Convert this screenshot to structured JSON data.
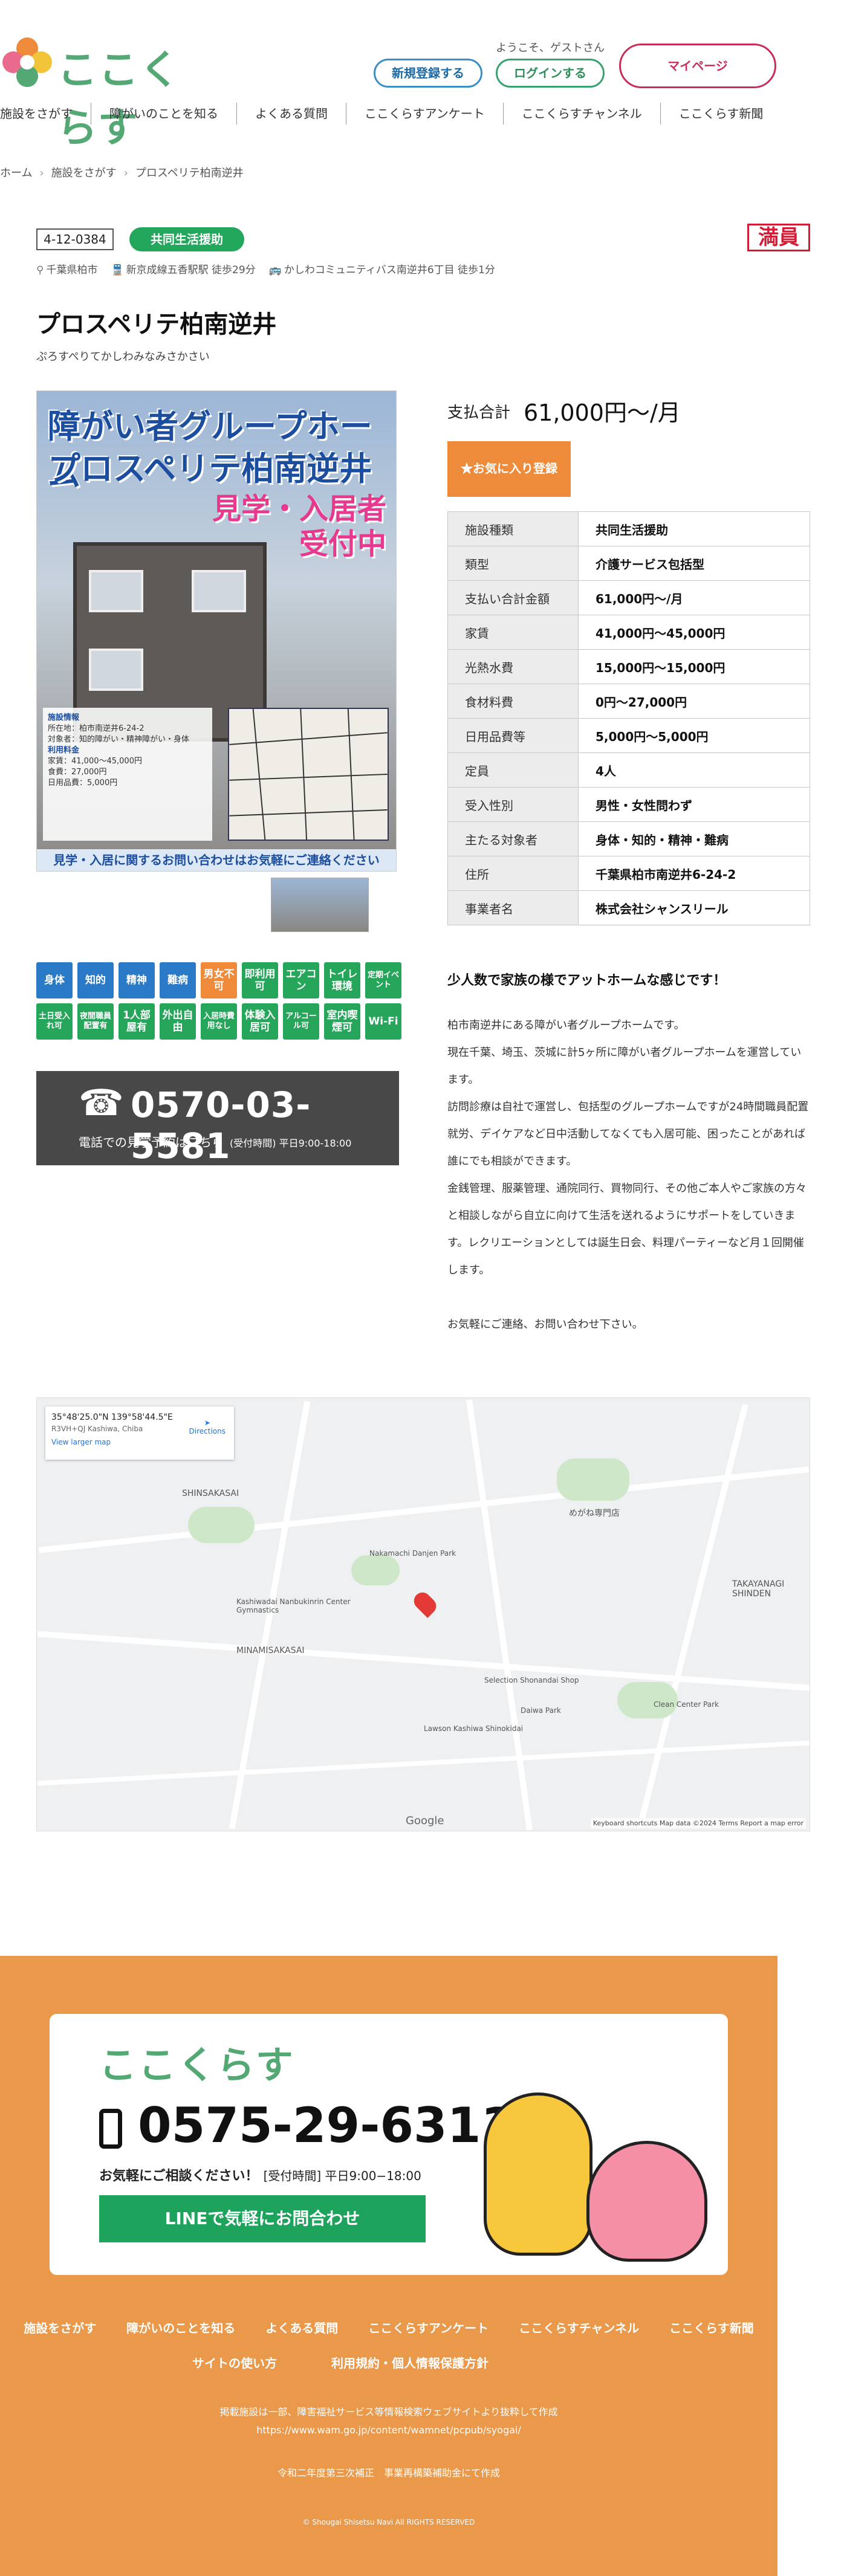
{
  "header": {
    "logo_text": "ここくらす",
    "welcome": "ようこそ、ゲストさん",
    "register_label": "新規登録する",
    "login_label": "ログインする",
    "mypage_label": "マイページ"
  },
  "nav": [
    "施設をさがす",
    "障がいのことを知る",
    "よくある質問",
    "ここくらすアンケート",
    "ここくらすチャンネル",
    "ここくらす新聞"
  ],
  "breadcrumb": [
    "ホーム",
    "施設をさがす",
    "プロスペリテ柏南逆井"
  ],
  "facility": {
    "id": "4-12-0384",
    "type": "共同生活援助",
    "status": "満員",
    "location": "千葉県柏市",
    "station": "新京成線五香駅駅 徒歩29分",
    "bus": "かしわコミュニティバス南逆井6丁目 徒歩1分",
    "name": "プロスペリテ柏南逆井",
    "kana": "ぷろすぺりてかしわみなみさかさい"
  },
  "photo": {
    "title_line1": "障がい者グループホーム",
    "title_line2": "プロスペリテ柏南逆井",
    "visit_line1": "見学・入居者",
    "visit_line2": "受付中",
    "info_title": "施設情報",
    "info_lines": [
      "所在地：柏市南逆井6-24-2",
      "対象者：知的障がい・精神障がい・身体",
      "利用料金",
      "家賃：41,000〜45,000円",
      "食費：27,000円",
      "日用品費：5,000円"
    ],
    "bottom": "見学・入居に関するお問い合わせはお気軽にご連絡ください"
  },
  "pricing": {
    "label": "支払合計",
    "value": "61,000円〜/月",
    "favorite_label": "★お気に入り登録"
  },
  "specs": [
    {
      "k": "施設種類",
      "v": "共同生活援助"
    },
    {
      "k": "類型",
      "v": "介護サービス包括型"
    },
    {
      "k": "支払い合計金額",
      "v": "61,000円〜/月"
    },
    {
      "k": "家賃",
      "v": "41,000円〜45,000円"
    },
    {
      "k": "光熱水費",
      "v": "15,000円〜15,000円"
    },
    {
      "k": "食材料費",
      "v": "0円〜27,000円"
    },
    {
      "k": "日用品費等",
      "v": "5,000円〜5,000円"
    },
    {
      "k": "定員",
      "v": "4人"
    },
    {
      "k": "受入性別",
      "v": "男性・女性問わず"
    },
    {
      "k": "主たる対象者",
      "v": "身体・知的・精神・難病"
    },
    {
      "k": "住所",
      "v": "千葉県柏市南逆井6-24-2"
    },
    {
      "k": "事業者名",
      "v": "株式会社シャンスリール"
    }
  ],
  "chips": [
    {
      "label": "身体",
      "color": "blue"
    },
    {
      "label": "知的",
      "color": "blue"
    },
    {
      "label": "精神",
      "color": "blue"
    },
    {
      "label": "難病",
      "color": "blue"
    },
    {
      "label": "男女不可",
      "color": "orange"
    },
    {
      "label": "即利用可",
      "color": "green"
    },
    {
      "label": "エアコン",
      "color": "green"
    },
    {
      "label": "トイレ環境",
      "color": "green"
    },
    {
      "label": "定期イベント",
      "color": "green"
    },
    {
      "label": "土日受入れ可",
      "color": "green"
    },
    {
      "label": "夜間職員配置有",
      "color": "green"
    },
    {
      "label": "1人部屋有",
      "color": "green"
    },
    {
      "label": "外出自由",
      "color": "green"
    },
    {
      "label": "入居時費用なし",
      "color": "green"
    },
    {
      "label": "体験入居可",
      "color": "green"
    },
    {
      "label": "アルコール可",
      "color": "green"
    },
    {
      "label": "室内喫煙可",
      "color": "green"
    },
    {
      "label": "Wi-Fi",
      "color": "green"
    }
  ],
  "contact": {
    "phone": "0570-03-5581",
    "note": "電話での見学予約はこちら",
    "hours": "(受付時間) 平日9:00-18:00"
  },
  "description": {
    "heading": "少人数で家族の様でアットホームな感じです！",
    "paragraphs": [
      "柏市南逆井にある障がい者グループホームです。",
      "現在千葉、埼玉、茨城に計5ヶ所に障がい者グループホームを運営しています。",
      "訪問診療は自社で運営し、包括型のグループホームですが24時間職員配置就労、デイケアなど日中活動してなくても入居可能、困ったことがあれば誰にでも相談ができます。",
      "金銭管理、服薬管理、通院同行、買物同行、その他ご本人やご家族の方々と相談しながら自立に向けて生活を送れるようにサポートをしていきます。レクリエーションとしては誕生日会、料理パーティーなど月１回開催します。",
      "",
      "お気軽にご連絡、お問い合わせ下さい。"
    ]
  },
  "map": {
    "coords": "35°48'25.0\"N 139°58'44.5\"E",
    "plus_code": "R3VH+QJ Kashiwa, Chiba",
    "larger": "View larger map",
    "directions": "Directions",
    "labels": [
      "SHINSAKASAI",
      "MINAMISAKASAI",
      "TAKAYANAGI SHINDEN",
      "Kashiwadai Nanbukinrin Center Gymnastics",
      "Lawson Kashiwa Shinokidai",
      "Selection Shonandai Shop",
      "めがね専門店",
      "Daiwa Park",
      "Clean Center Park",
      "Nakamachi Danjen Park"
    ],
    "attribution": "Keyboard shortcuts  Map data ©2024  Terms  Report a map error",
    "google": "Google"
  },
  "footer": {
    "logo": "ここくらす",
    "phone": "0575-29-6311",
    "note": "お気軽にご相談ください！",
    "hours": "[受付時間] 平日9:00−18:00",
    "line_label": "LINEで気軽にお問合わせ",
    "nav1": [
      "施設をさがす",
      "障がいのことを知る",
      "よくある質問",
      "ここくらすアンケート",
      "ここくらすチャンネル",
      "ここくらす新聞"
    ],
    "nav2": [
      "サイトの使い方",
      "利用規約・個人情報保護方針"
    ],
    "source": "掲載施設は一部、障害福祉サービス等情報検索ウェブサイトより抜粋して作成",
    "source_url": "https://www.wam.go.jp/content/wamnet/pcpub/syogai/",
    "subsidy": "令和二年度第三次補正　事業再構築補助金にて作成",
    "copyright": "© Shougai Shisetsu Navi All RIGHTS RESERVED"
  }
}
